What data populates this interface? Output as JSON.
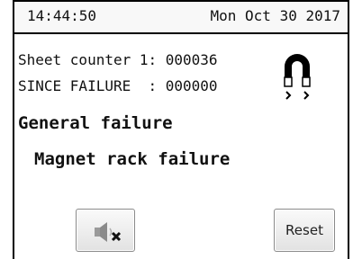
{
  "header": {
    "time": "14:44:50",
    "date": "Mon Oct 30 2017"
  },
  "counters": {
    "sheet_counter": "Sheet counter 1: 000036",
    "since_failure": "SINCE FAILURE  : 000000"
  },
  "status": {
    "general": "General failure",
    "detail": "Magnet rack failure"
  },
  "buttons": {
    "reset_label": "Reset",
    "mute_icon": "speaker-mute-icon"
  },
  "icons": {
    "status_icon": "magnet-icon"
  }
}
